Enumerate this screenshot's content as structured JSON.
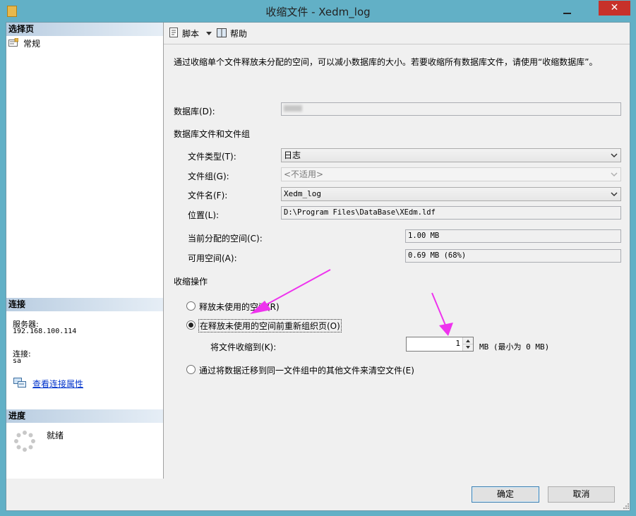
{
  "window": {
    "title": "收缩文件 - Xedm_log",
    "close_glyph": "✕"
  },
  "left_pane": {
    "select_page_header": "选择页",
    "pages": [
      {
        "label": "常规",
        "icon": "properties-page-icon"
      }
    ],
    "connection_header": "连接",
    "server_label": "服务器:",
    "server_value": "192.168.100.114",
    "connection_label": "连接:",
    "connection_value": "sa",
    "view_connection_link": "查看连接属性",
    "progress_header": "进度",
    "progress_status": "就绪"
  },
  "toolbar": {
    "script_label": "脚本",
    "help_label": "帮助"
  },
  "content": {
    "description": "通过收缩单个文件释放未分配的空间，可以减小数据库的大小。若要收缩所有数据库文件，请使用“收缩数据库”。",
    "database_label": "数据库(D):",
    "database_value": "",
    "files_group_header": "数据库文件和文件组",
    "file_type_label": "文件类型(T):",
    "file_type_value": "日志",
    "filegroup_label": "文件组(G):",
    "filegroup_value": "<不适用>",
    "file_name_label": "文件名(F):",
    "file_name_value": "Xedm_log",
    "location_label": "位置(L):",
    "location_value": "D:\\Program Files\\DataBase\\XEdm.ldf",
    "allocated_label": "当前分配的空间(C):",
    "allocated_value": "1.00 MB",
    "free_label": "可用空间(A):",
    "free_value": "0.69 MB (68%)",
    "shrink_action_header": "收缩操作",
    "option_release": "释放未使用的空间(R)",
    "option_reorganize": "在释放未使用的空间前重新组织页(O)",
    "shrink_to_label": "将文件收缩到(K):",
    "shrink_to_value": "1",
    "shrink_to_unit": "MB (最小为 0 MB)",
    "option_empty": "通过将数据迁移到同一文件组中的其他文件来清空文件(E)",
    "selected_option": "reorganize"
  },
  "footer": {
    "ok_label": "确定",
    "cancel_label": "取消"
  },
  "colors": {
    "frame": "#62b0c6",
    "close_button": "#c7312a",
    "annotation_arrow": "#ee33ee",
    "link": "#0033cc"
  }
}
